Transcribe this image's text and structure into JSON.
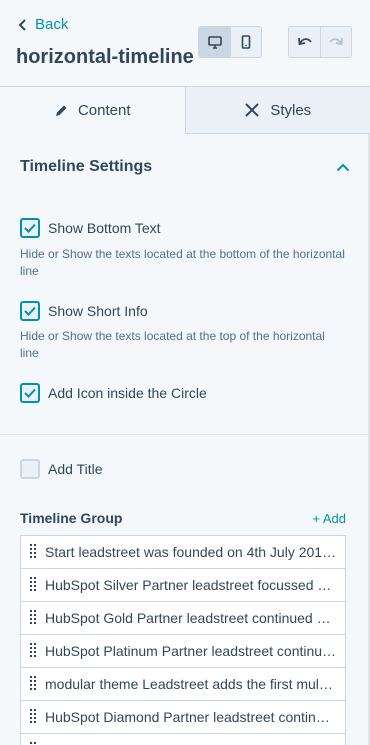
{
  "header": {
    "back_label": "Back",
    "title": "horizontal-timeline"
  },
  "tabs": [
    {
      "label": "Content",
      "icon": "pencil-icon",
      "active": true
    },
    {
      "label": "Styles",
      "icon": "scissors-icon",
      "active": false
    }
  ],
  "section": {
    "title": "Timeline Settings",
    "expanded": true
  },
  "settings": {
    "show_bottom_text": {
      "label": "Show Bottom Text",
      "checked": true,
      "help": "Hide or Show the texts located at the bottom of the horizontal line"
    },
    "show_short_info": {
      "label": "Show Short Info",
      "checked": true,
      "help": "Hide or Show the texts located at the top of the horizontal line"
    },
    "add_icon": {
      "label": "Add Icon inside the Circle",
      "checked": true
    },
    "add_title": {
      "label": "Add Title",
      "checked": false
    }
  },
  "timeline_group": {
    "title": "Timeline Group",
    "add_label": "+ Add",
    "items": [
      "Start leadstreet was founded on 4th July 201…",
      "HubSpot Silver Partner leadstreet focussed 1…",
      "HubSpot Gold Partner leadstreet continued …",
      "HubSpot Platinum Partner leadstreet continu…",
      "modular theme Leadstreet adds the first mul…",
      "HubSpot Diamond Partner leadstreet contin…"
    ]
  },
  "colors": {
    "accent": "#0091ae",
    "text": "#33475b",
    "border": "#cbd6e2"
  }
}
